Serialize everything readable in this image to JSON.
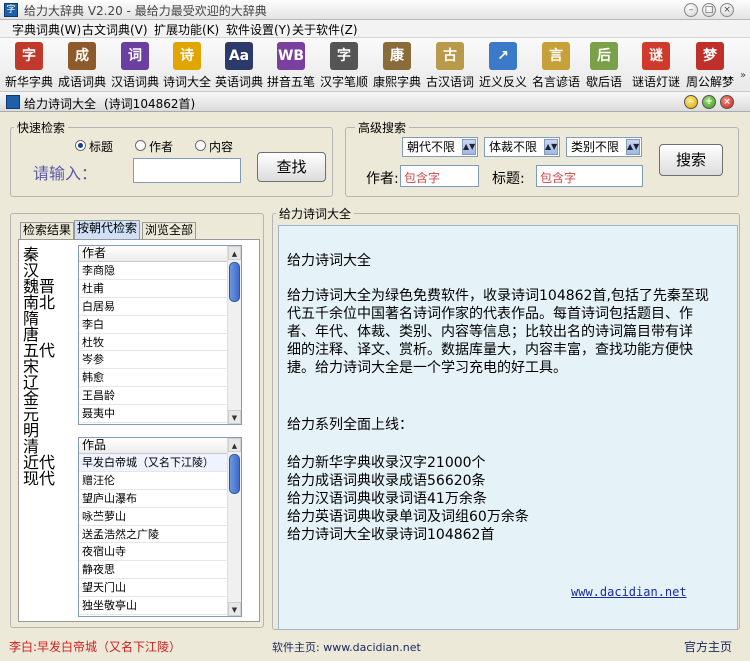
{
  "window": {
    "title": "给力大辞典 V2.20  -  最给力最受欢迎的大辞典",
    "icon": "app-logo-icon"
  },
  "menu": [
    "字典词典(W)",
    "古文词典(V)",
    "扩展功能(K)",
    "软件设置(Y)",
    "关于软件(Z)"
  ],
  "toolbar": [
    {
      "label": "新华字典",
      "glyph": "字",
      "color": "#c0392b"
    },
    {
      "label": "成语词典",
      "glyph": "成",
      "color": "#8e5a2b"
    },
    {
      "label": "汉语词典",
      "glyph": "词",
      "color": "#6a3fa0"
    },
    {
      "label": "诗词大全",
      "glyph": "诗",
      "color": "#e2a400"
    },
    {
      "label": "英语词典",
      "glyph": "Aa",
      "color": "#2b3a6a"
    },
    {
      "label": "拼音五笔",
      "glyph": "WB",
      "color": "#7b3fa0"
    },
    {
      "label": "汉字笔顺",
      "glyph": "字",
      "color": "#555555"
    },
    {
      "label": "康熙字典",
      "glyph": "康",
      "color": "#8a6b3a"
    },
    {
      "label": "古汉语词",
      "glyph": "古",
      "color": "#b89a4a"
    },
    {
      "label": "近义反义",
      "glyph": "↗",
      "color": "#3a7ac8"
    },
    {
      "label": "名言谚语",
      "glyph": "言",
      "color": "#c8a03a"
    },
    {
      "label": "歇后语",
      "glyph": "后",
      "color": "#7aa04a"
    },
    {
      "label": "谜语灯谜",
      "glyph": "谜",
      "color": "#d03a2a"
    },
    {
      "label": "周公解梦",
      "glyph": "梦",
      "color": "#c0302a"
    }
  ],
  "subwindow": {
    "title": "给力诗词大全",
    "count": "(诗词104862首)"
  },
  "quick_search": {
    "legend": "快速检索",
    "options": [
      "标题",
      "作者",
      "内容"
    ],
    "selected": "标题",
    "input_label": "请输入：",
    "search_button": "查找"
  },
  "advanced_search": {
    "legend": "高级搜索",
    "selects": [
      "朝代不限",
      "体裁不限",
      "类别不限"
    ],
    "author_label": "作者:",
    "author_placeholder": "包含字",
    "title_label": "标题:",
    "title_placeholder": "包含字",
    "search_button": "搜索"
  },
  "tabs": [
    "检索结果",
    "按朝代检索",
    "浏览全部"
  ],
  "active_tab": "按朝代检索",
  "dynasties": [
    "秦",
    "汉",
    "魏晋",
    "南北",
    "隋",
    "唐",
    "五代",
    "宋",
    "辽",
    "金",
    "元",
    "明",
    "清",
    "近代",
    "现代"
  ],
  "authors": {
    "header": "作者",
    "items": [
      "李商隐",
      "杜甫",
      "白居易",
      "李白",
      "杜牧",
      "岑参",
      "韩愈",
      "王昌龄",
      "聂夷中"
    ]
  },
  "works": {
    "header": "作品",
    "items": [
      "早发白帝城（又名下江陵）",
      "赠汪伦",
      "望庐山瀑布",
      "咏苎萝山",
      "送孟浩然之广陵",
      "夜宿山寺",
      "静夜思",
      "望天门山",
      "独坐敬亭山"
    ]
  },
  "content": {
    "legend": "给力诗词大全",
    "title": "给力诗词大全",
    "para": [
      "给力诗词大全为绿色免费软件，收录诗词104862首,包括了先秦至现",
      "代五千余位中国著名诗词作家的代表作品。每首诗词包括题目、作",
      "者、年代、体裁、类别、内容等信息；比较出名的诗词篇目带有详",
      "细的注释、译文、赏析。数据库量大，内容丰富，查找功能方便快",
      "捷。给力诗词大全是一个学习充电的好工具。"
    ],
    "series_title": "给力系列全面上线：",
    "series": [
      "给力新华字典收录汉字21000个",
      "给力成语词典收录成语56620条",
      "给力汉语词典收录词语41万余条",
      "给力英语词典收录单词及词组60万余条",
      "给力诗词大全收录诗词104862首"
    ],
    "link": "www.dacidian.net"
  },
  "status": {
    "current": "李白:早发白帝城（又名下江陵）",
    "homepage": "软件主页: www.dacidian.net",
    "official": "官方主页"
  }
}
